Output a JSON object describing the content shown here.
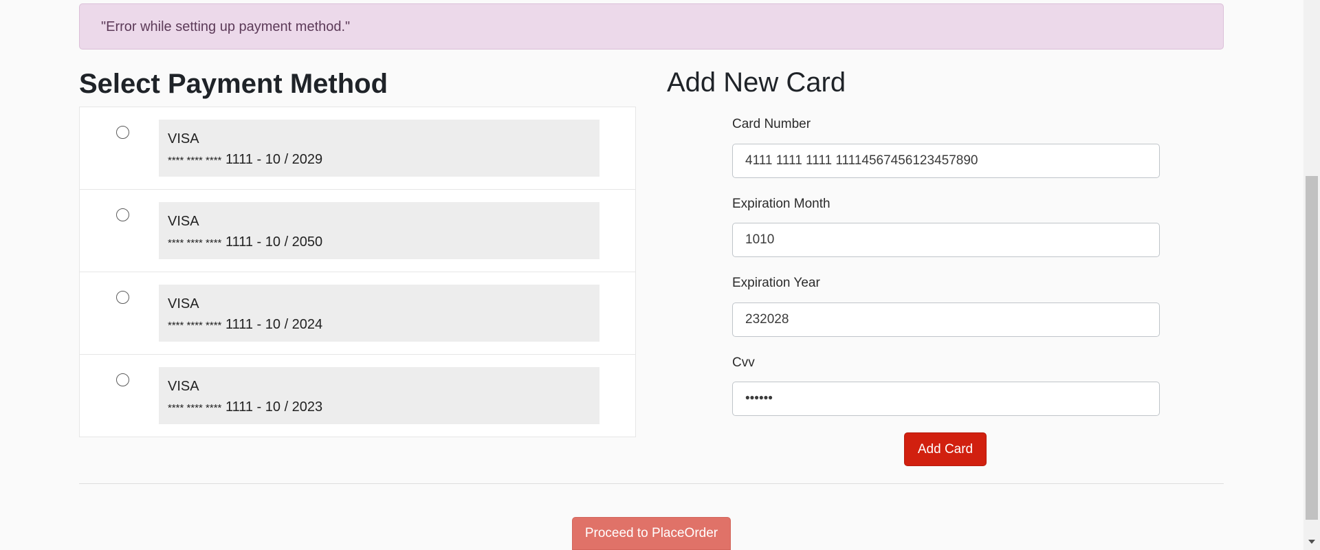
{
  "alert": {
    "message": "\"Error while setting up payment method.\""
  },
  "payment_methods": {
    "title": "Select Payment Method",
    "cards": [
      {
        "brand": "VISA",
        "masked": "**** **** ****",
        "last4_and_expiry": "1111 - 10 / 2029"
      },
      {
        "brand": "VISA",
        "masked": "**** **** ****",
        "last4_and_expiry": "1111 - 10 / 2050"
      },
      {
        "brand": "VISA",
        "masked": "**** **** ****",
        "last4_and_expiry": "1111 - 10 / 2024"
      },
      {
        "brand": "VISA",
        "masked": "**** **** ****",
        "last4_and_expiry": "1111 - 10 / 2023"
      }
    ]
  },
  "add_card": {
    "title": "Add New Card",
    "card_number_label": "Card Number",
    "card_number_value": "4111 1111 1111 11114567456123457890",
    "exp_month_label": "Expiration Month",
    "exp_month_value": "1010",
    "exp_year_label": "Expiration Year",
    "exp_year_value": "232028",
    "cvv_label": "Cvv",
    "cvv_value": "••••••",
    "submit_label": "Add Card"
  },
  "footer": {
    "proceed_label": "Proceed to PlaceOrder"
  },
  "colors": {
    "alert_bg": "#ecd9ea",
    "add_button": "#d1200f",
    "proceed_button": "#e07268"
  }
}
